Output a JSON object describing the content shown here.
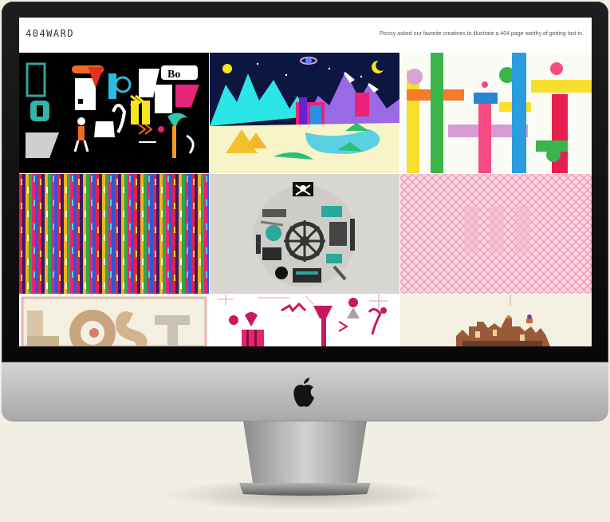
{
  "site": {
    "brand": "404WARD",
    "tagline": "Piccsy asked our favorite creatives to illustrate a 404 page worthy of getting lost in."
  },
  "gallery": {
    "tiles": [
      {
        "subject": "city-collage",
        "bg": "#000000"
      },
      {
        "subject": "mountain-landscape",
        "bg": "#0c1640"
      },
      {
        "subject": "color-bars",
        "bg": "#fbfbf6"
      },
      {
        "subject": "pattern-stripes",
        "bg": "#5a1e60"
      },
      {
        "subject": "pirate-circle",
        "bg": "#d8d6d1"
      },
      {
        "subject": "pink-pattern",
        "bg": "#f7c7d6"
      },
      {
        "subject": "lost-letters",
        "bg": "#ffffff"
      },
      {
        "subject": "map-icons",
        "bg": "#ffffff"
      },
      {
        "subject": "skyline-ellipse",
        "bg": "#f3f0e2"
      }
    ]
  },
  "colors": {
    "accent": "#c8175f",
    "bezel": "#111111",
    "chin": "#c6c6c6",
    "background": "#f1eee3"
  }
}
